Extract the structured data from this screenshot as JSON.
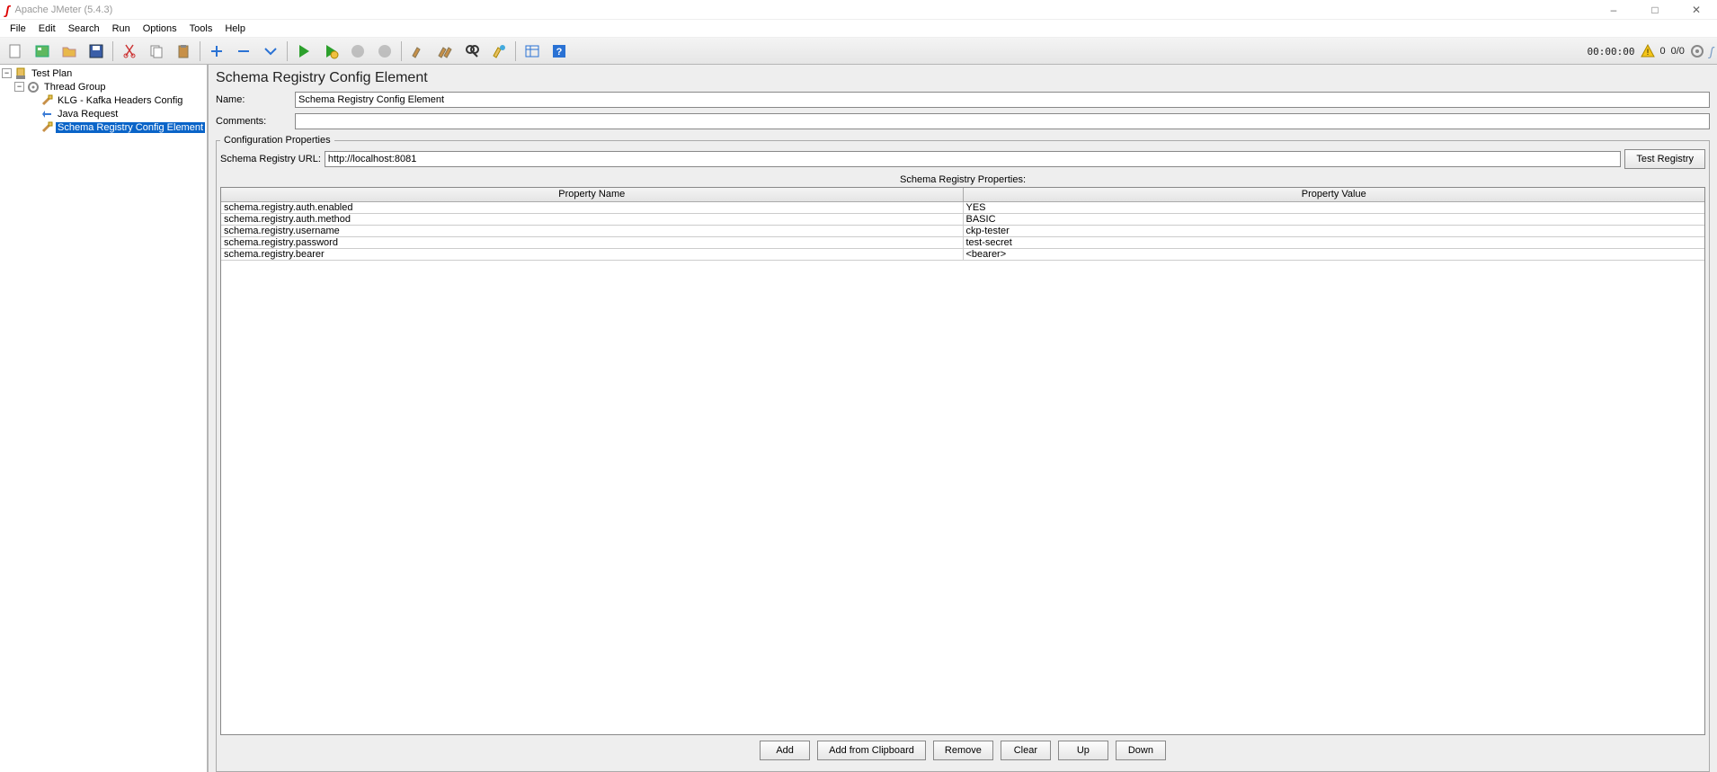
{
  "window": {
    "title": "Apache JMeter (5.4.3)"
  },
  "menu": {
    "file": "File",
    "edit": "Edit",
    "search": "Search",
    "run": "Run",
    "options": "Options",
    "tools": "Tools",
    "help": "Help"
  },
  "toolbar_status": {
    "time": "00:00:00",
    "warn_count": "0",
    "thread_count": "0/0"
  },
  "tree": {
    "test_plan": "Test Plan",
    "thread_group": "Thread Group",
    "kafka_headers": "KLG - Kafka Headers Config",
    "java_request": "Java Request",
    "schema_registry": "Schema Registry Config Element"
  },
  "panel": {
    "title": "Schema Registry Config Element",
    "name_label": "Name:",
    "name_value": "Schema Registry Config Element",
    "comments_label": "Comments:",
    "comments_value": "",
    "fieldset_legend": "Configuration Properties",
    "url_label": "Schema Registry URL:",
    "url_value": "http://localhost:8081",
    "test_registry_btn": "Test Registry",
    "props_title": "Schema Registry Properties:",
    "col_name": "Property Name",
    "col_value": "Property Value",
    "rows": [
      {
        "name": "schema.registry.auth.enabled",
        "value": "YES"
      },
      {
        "name": "schema.registry.auth.method",
        "value": "BASIC"
      },
      {
        "name": "schema.registry.username",
        "value": "ckp-tester"
      },
      {
        "name": "schema.registry.password",
        "value": "test-secret"
      },
      {
        "name": "schema.registry.bearer",
        "value": "<bearer>"
      }
    ],
    "buttons": {
      "add": "Add",
      "add_clip": "Add from Clipboard",
      "remove": "Remove",
      "clear": "Clear",
      "up": "Up",
      "down": "Down"
    }
  }
}
